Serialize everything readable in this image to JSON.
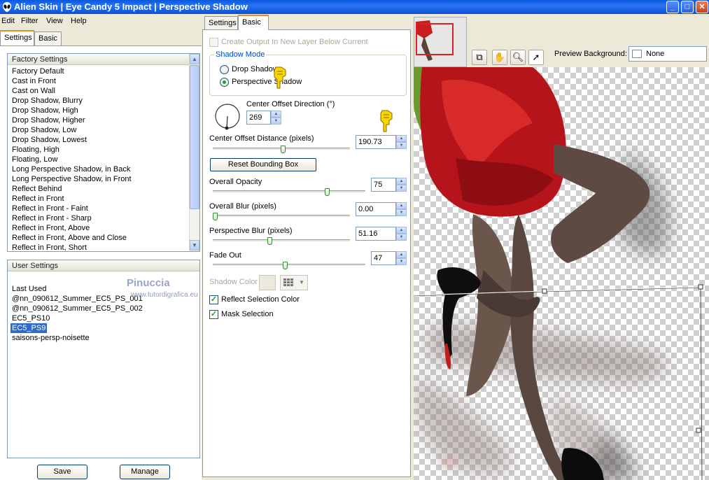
{
  "window": {
    "title": "Alien Skin  |  Eye Candy 5 Impact  |  Perspective Shadow",
    "minimize": "_",
    "maximize": "□",
    "close": "✕"
  },
  "menu": [
    "Edit",
    "Filter",
    "View",
    "Help"
  ],
  "left_tabs": [
    "Settings",
    "Basic"
  ],
  "factory_settings": {
    "header": "Factory Settings",
    "items": [
      "Factory Default",
      "Cast in Front",
      "Cast on Wall",
      "Drop Shadow, Blurry",
      "Drop Shadow, High",
      "Drop Shadow, Higher",
      "Drop Shadow, Low",
      "Drop Shadow, Lowest",
      "Floating, High",
      "Floating, Low",
      "Long Perspective Shadow, in Back",
      "Long Perspective Shadow, in Front",
      "Reflect Behind",
      "Reflect in Front",
      "Reflect in Front - Faint",
      "Reflect in Front - Sharp",
      "Reflect in Front, Above",
      "Reflect in Front, Above and Close",
      "Reflect in Front, Short"
    ]
  },
  "user_settings": {
    "header": "User Settings",
    "items": [
      "Last Used",
      "@nn_090612_Summer_EC5_PS_001",
      "@nn_090612_Summer_EC5_PS_002",
      "EC5_PS10",
      "EC5_PS9",
      "saisons-persp-noisette"
    ],
    "selected": "EC5_PS9",
    "watermark": "Pinuccia",
    "watermark_url": "www.tutordigrafica.eu"
  },
  "buttons": {
    "save": "Save",
    "manage": "Manage"
  },
  "mid_tabs": [
    "Settings",
    "Basic"
  ],
  "basic": {
    "create_output": "Create Output In New Layer Below Current",
    "shadow_mode_legend": "Shadow Mode",
    "drop_shadow": "Drop Shadow",
    "perspective_shadow": "Perspective Shadow",
    "center_offset_direction_label": "Center Offset Direction (°)",
    "center_offset_direction": "269",
    "center_offset_distance_label": "Center Offset Distance (pixels)",
    "center_offset_distance": "190.73",
    "center_offset_distance_level": 0.5,
    "reset_bounding_box": "Reset Bounding Box",
    "overall_opacity_label": "Overall Opacity",
    "overall_opacity": "75",
    "overall_blur_label": "Overall Blur (pixels)",
    "overall_blur": "0.00",
    "perspective_blur_label": "Perspective Blur (pixels)",
    "perspective_blur": "51.16",
    "fade_out_label": "Fade Out",
    "fade_out": "47",
    "shadow_color_label": "Shadow Color",
    "reflect_selection_color": "Reflect Selection Color",
    "mask_selection": "Mask Selection"
  },
  "preview": {
    "background_label": "Preview Background:",
    "background_value": "None"
  }
}
